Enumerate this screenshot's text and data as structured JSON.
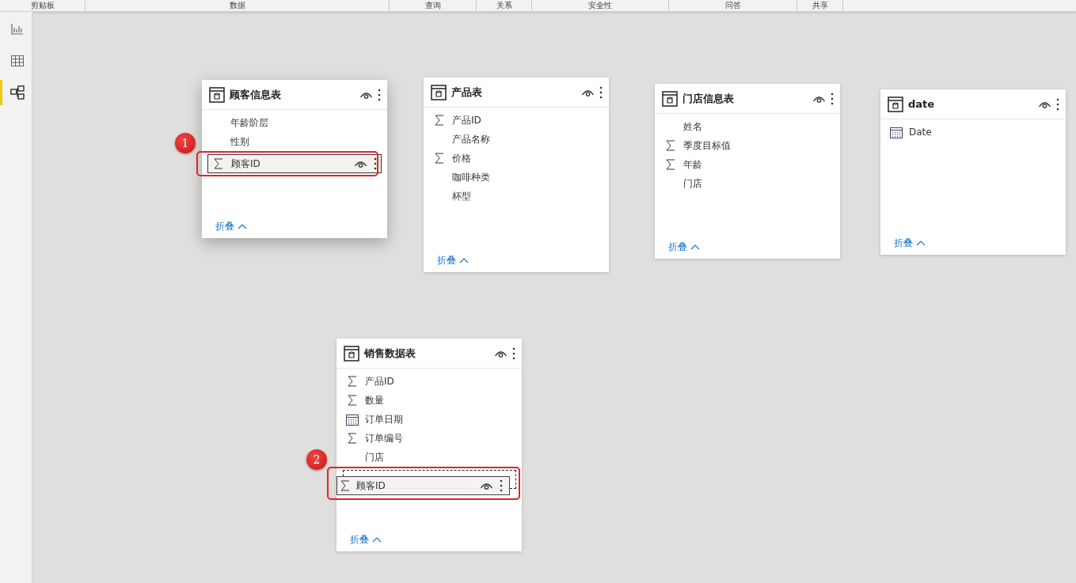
{
  "ribbon_groups": [
    "剪贴板",
    "数据",
    "查询",
    "关系",
    "安全性",
    "问答",
    "共享"
  ],
  "view_switcher": [
    {
      "kind": "report",
      "selected": false
    },
    {
      "kind": "data",
      "selected": false
    },
    {
      "kind": "model",
      "selected": true
    }
  ],
  "tables": [
    {
      "title": "顾客信息表",
      "collapse_label": "折叠",
      "fields": [
        {
          "name": "年龄阶层",
          "kind": "text",
          "selected": false,
          "dragging": false
        },
        {
          "name": "性别",
          "kind": "text",
          "selected": false,
          "dragging": false
        },
        {
          "name": "顾客ID",
          "kind": "sum",
          "selected": true,
          "dragging": false,
          "callout": "1"
        }
      ]
    },
    {
      "title": "产品表",
      "collapse_label": "折叠",
      "fields": [
        {
          "name": "产品ID",
          "kind": "sum",
          "selected": false,
          "dragging": false
        },
        {
          "name": "产品名称",
          "kind": "text",
          "selected": false,
          "dragging": false
        },
        {
          "name": "价格",
          "kind": "sum",
          "selected": false,
          "dragging": false
        },
        {
          "name": "咖啡种类",
          "kind": "text",
          "selected": false,
          "dragging": false
        },
        {
          "name": "杯型",
          "kind": "text",
          "selected": false,
          "dragging": false
        }
      ]
    },
    {
      "title": "门店信息表",
      "collapse_label": "折叠",
      "fields": [
        {
          "name": "姓名",
          "kind": "text",
          "selected": false,
          "dragging": false
        },
        {
          "name": "季度目标值",
          "kind": "sum",
          "selected": false,
          "dragging": false
        },
        {
          "name": "年龄",
          "kind": "sum",
          "selected": false,
          "dragging": false
        },
        {
          "name": "门店",
          "kind": "text",
          "selected": false,
          "dragging": false
        }
      ]
    },
    {
      "title": "date",
      "collapse_label": "折叠",
      "fields": [
        {
          "name": "Date",
          "kind": "date",
          "selected": false,
          "dragging": false
        }
      ]
    },
    {
      "title": "销售数据表",
      "collapse_label": "折叠",
      "fields": [
        {
          "name": "产品ID",
          "kind": "sum",
          "selected": false,
          "dragging": false
        },
        {
          "name": "数量",
          "kind": "sum",
          "selected": false,
          "dragging": false
        },
        {
          "name": "订单日期",
          "kind": "date",
          "selected": false,
          "dragging": false
        },
        {
          "name": "订单编号",
          "kind": "sum",
          "selected": false,
          "dragging": false
        },
        {
          "name": "门店",
          "kind": "text",
          "selected": false,
          "dragging": false
        },
        {
          "name": "顾客ID",
          "kind": "sum",
          "selected": false,
          "dragging": true,
          "callout": "2"
        }
      ]
    }
  ]
}
